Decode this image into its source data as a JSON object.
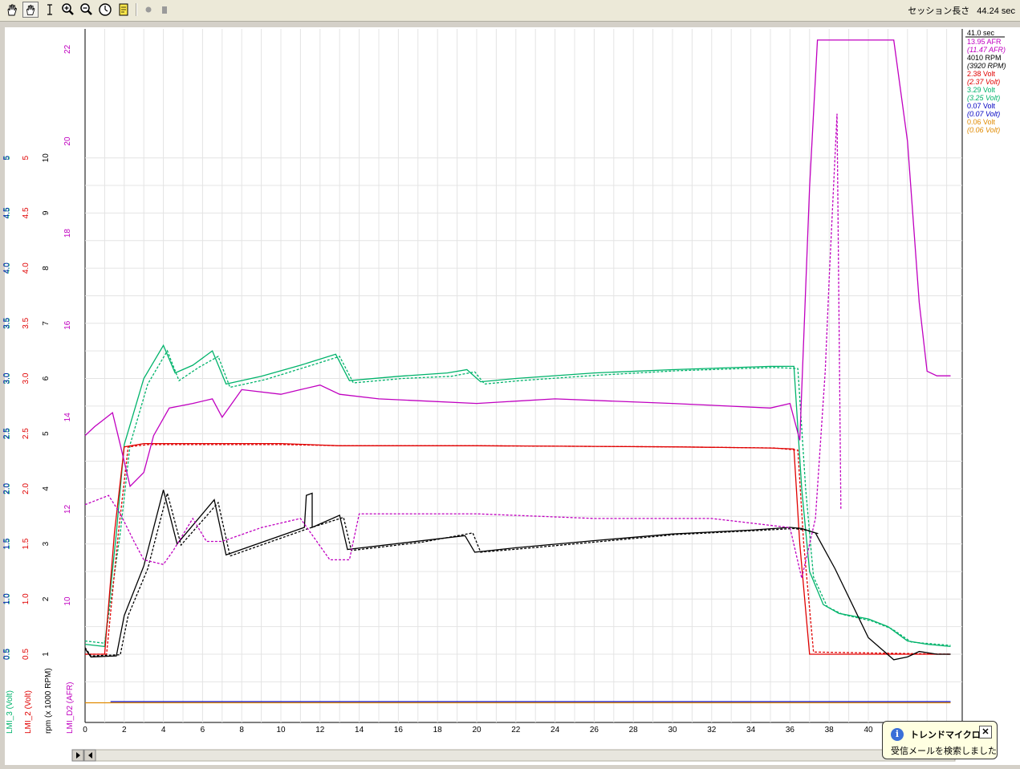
{
  "toolbar": {
    "icons": [
      "hand-icon",
      "pan-icon",
      "cursor-i-icon",
      "zoom-in-icon",
      "zoom-out-icon",
      "timer-icon",
      "notes-icon",
      "record-icon",
      "stop-icon"
    ],
    "session_label": "セッション長さ",
    "session_value": "44.24 sec"
  },
  "chart_data": {
    "type": "line",
    "x": {
      "range": [
        0,
        44.24
      ],
      "ticks": [
        0,
        2,
        4,
        6,
        8,
        10,
        12,
        14,
        16,
        18,
        20,
        22,
        24,
        26,
        28,
        30,
        32,
        34,
        36,
        38,
        40
      ]
    },
    "axes": [
      {
        "name": "LMI_3 (Volt)",
        "color": "#00b36b",
        "ticks": [
          "0.5",
          "1.0",
          "1.5",
          "2.0",
          "2.5",
          "3.0",
          "3.5",
          "4.0",
          "4.5",
          "5"
        ]
      },
      {
        "name": "LMI_2 (Volt)",
        "color": "#e00000",
        "ticks": [
          "0.5",
          "1.0",
          "1.5",
          "2.0",
          "2.5",
          "3.0",
          "3.5",
          "4.0",
          "4.5",
          "5"
        ]
      },
      {
        "name": "rpm (x 1000 RPM)",
        "color": "#000000",
        "ticks": [
          "1",
          "2",
          "3",
          "4",
          "5",
          "6",
          "7",
          "8",
          "9",
          "10"
        ]
      },
      {
        "name": "LMI_D2 (AFR)",
        "color": "#c000c0",
        "ticks": [
          "10",
          "12",
          "14",
          "16",
          "18",
          "20",
          "22"
        ]
      }
    ],
    "extra_axis": {
      "color": "#0000c0",
      "ticks": [
        "0.5",
        "1.0",
        "1.5",
        "2.0",
        "2.5",
        "3.0",
        "3.5",
        "4.0",
        "4.5",
        "5"
      ]
    },
    "cursor": {
      "time": "41.0 sec",
      "readouts": [
        {
          "text": "13.95 AFR",
          "color": "#c000c0",
          "italic": false
        },
        {
          "text": "(11.47 AFR)",
          "color": "#c000c0",
          "italic": true
        },
        {
          "text": "4010 RPM",
          "color": "#000000",
          "italic": false
        },
        {
          "text": "(3920 RPM)",
          "color": "#000000",
          "italic": true
        },
        {
          "text": "2.38 Volt",
          "color": "#e00000",
          "italic": false
        },
        {
          "text": "(2.37 Volt)",
          "color": "#e00000",
          "italic": true
        },
        {
          "text": "3.29 Volt",
          "color": "#00b36b",
          "italic": false
        },
        {
          "text": "(3.25 Volt)",
          "color": "#00b36b",
          "italic": true
        },
        {
          "text": "0.07 Volt",
          "color": "#0000c0",
          "italic": false
        },
        {
          "text": "(0.07 Volt)",
          "color": "#0000c0",
          "italic": true
        },
        {
          "text": "0.06 Volt",
          "color": "#e08a00",
          "italic": false
        },
        {
          "text": "(0.06 Volt)",
          "color": "#e08a00",
          "italic": true
        }
      ]
    },
    "series": [
      {
        "color": "#00b36b",
        "dashed": false,
        "points": [
          [
            0,
            0.59
          ],
          [
            1,
            0.57
          ],
          [
            1.6,
            1.6
          ],
          [
            2,
            2.4
          ],
          [
            3,
            3.0
          ],
          [
            4,
            3.3
          ],
          [
            4.6,
            3.05
          ],
          [
            5.5,
            3.12
          ],
          [
            6.5,
            3.25
          ],
          [
            7.2,
            2.95
          ],
          [
            9,
            3.02
          ],
          [
            11,
            3.12
          ],
          [
            12.8,
            3.22
          ],
          [
            13.5,
            2.98
          ],
          [
            16,
            3.02
          ],
          [
            18.5,
            3.05
          ],
          [
            19.5,
            3.08
          ],
          [
            20.2,
            2.97
          ],
          [
            22,
            3.0
          ],
          [
            26,
            3.05
          ],
          [
            30,
            3.08
          ],
          [
            35,
            3.11
          ],
          [
            36.2,
            3.11
          ],
          [
            36.6,
            2.0
          ],
          [
            37,
            1.25
          ],
          [
            37.7,
            0.95
          ],
          [
            38.5,
            0.87
          ],
          [
            40,
            0.82
          ],
          [
            41,
            0.75
          ],
          [
            42,
            0.62
          ],
          [
            43,
            0.59
          ],
          [
            44.2,
            0.57
          ]
        ]
      },
      {
        "color": "#00b36b",
        "dashed": true,
        "points": [
          [
            0,
            0.62
          ],
          [
            1,
            0.6
          ],
          [
            1.8,
            1.6
          ],
          [
            2.3,
            2.4
          ],
          [
            3.2,
            2.95
          ],
          [
            4.2,
            3.25
          ],
          [
            4.8,
            2.98
          ],
          [
            5.8,
            3.1
          ],
          [
            6.8,
            3.2
          ],
          [
            7.4,
            2.92
          ],
          [
            9.2,
            2.99
          ],
          [
            11.2,
            3.1
          ],
          [
            13,
            3.2
          ],
          [
            13.7,
            2.96
          ],
          [
            16.2,
            3.0
          ],
          [
            18.7,
            3.02
          ],
          [
            19.9,
            3.06
          ],
          [
            20.4,
            2.95
          ],
          [
            22.2,
            2.98
          ],
          [
            26.2,
            3.03
          ],
          [
            30.2,
            3.07
          ],
          [
            35.2,
            3.1
          ],
          [
            36.4,
            3.09
          ],
          [
            36.8,
            2.0
          ],
          [
            37.2,
            1.2
          ],
          [
            37.9,
            0.93
          ],
          [
            38.7,
            0.86
          ],
          [
            40.2,
            0.8
          ],
          [
            41.2,
            0.73
          ],
          [
            42.2,
            0.61
          ],
          [
            44.2,
            0.58
          ]
        ]
      },
      {
        "color": "#e00000",
        "dashed": false,
        "points": [
          [
            0,
            0.5
          ],
          [
            1,
            0.5
          ],
          [
            1.5,
            1.6
          ],
          [
            2,
            2.38
          ],
          [
            3,
            2.41
          ],
          [
            6,
            2.41
          ],
          [
            10,
            2.41
          ],
          [
            13,
            2.39
          ],
          [
            20,
            2.39
          ],
          [
            30,
            2.38
          ],
          [
            35,
            2.37
          ],
          [
            36.2,
            2.36
          ],
          [
            36.5,
            1.5
          ],
          [
            37,
            0.5
          ],
          [
            44.2,
            0.5
          ]
        ]
      },
      {
        "color": "#e00000",
        "dashed": true,
        "points": [
          [
            0,
            0.5
          ],
          [
            1.1,
            0.5
          ],
          [
            1.7,
            1.6
          ],
          [
            2.2,
            2.38
          ],
          [
            3.2,
            2.4
          ],
          [
            6.2,
            2.4
          ],
          [
            10.2,
            2.4
          ],
          [
            13.2,
            2.39
          ],
          [
            20.2,
            2.39
          ],
          [
            30.2,
            2.38
          ],
          [
            35.2,
            2.37
          ],
          [
            36.4,
            2.35
          ],
          [
            36.7,
            1.5
          ],
          [
            37.2,
            0.52
          ],
          [
            44.2,
            0.5
          ]
        ]
      },
      {
        "color": "#000000",
        "dashed": false,
        "points": [
          [
            0,
            1.1
          ],
          [
            0.3,
            0.95
          ],
          [
            1.6,
            0.97
          ],
          [
            2,
            1.7
          ],
          [
            3,
            2.6
          ],
          [
            4,
            3.98
          ],
          [
            4.7,
            3.0
          ],
          [
            6.6,
            3.8
          ],
          [
            7.2,
            2.8
          ],
          [
            11.2,
            3.3
          ],
          [
            11.3,
            3.88
          ],
          [
            11.6,
            3.92
          ],
          [
            11.6,
            3.3
          ],
          [
            13,
            3.52
          ],
          [
            13.4,
            2.9
          ],
          [
            17,
            3.05
          ],
          [
            19.4,
            3.15
          ],
          [
            19.9,
            2.85
          ],
          [
            22,
            2.93
          ],
          [
            26,
            3.06
          ],
          [
            30,
            3.18
          ],
          [
            34,
            3.25
          ],
          [
            36,
            3.3
          ],
          [
            36.6,
            3.28
          ],
          [
            37.3,
            3.2
          ],
          [
            38.3,
            2.55
          ],
          [
            40,
            1.3
          ],
          [
            41.3,
            0.9
          ],
          [
            42,
            0.95
          ],
          [
            42.6,
            1.05
          ],
          [
            43.5,
            1.0
          ],
          [
            44.2,
            1.0
          ]
        ]
      },
      {
        "color": "#000000",
        "dashed": true,
        "points": [
          [
            0,
            1.12
          ],
          [
            0.3,
            0.97
          ],
          [
            1.8,
            0.99
          ],
          [
            2.2,
            1.7
          ],
          [
            3.2,
            2.55
          ],
          [
            4.2,
            3.92
          ],
          [
            4.9,
            2.98
          ],
          [
            6.8,
            3.75
          ],
          [
            7.4,
            2.78
          ],
          [
            11.4,
            3.28
          ],
          [
            13.2,
            3.48
          ],
          [
            13.6,
            2.88
          ],
          [
            17.2,
            3.03
          ],
          [
            19.8,
            3.2
          ],
          [
            20.2,
            2.85
          ],
          [
            22.2,
            2.91
          ],
          [
            26.2,
            3.04
          ],
          [
            30.2,
            3.17
          ],
          [
            34.2,
            3.24
          ],
          [
            36.2,
            3.28
          ],
          [
            36.8,
            3.25
          ],
          [
            37.5,
            3.18
          ]
        ]
      },
      {
        "color": "#c000c0",
        "dashed": false,
        "points": [
          [
            0,
            13.6
          ],
          [
            0.5,
            13.8
          ],
          [
            1.4,
            14.1
          ],
          [
            1.8,
            13.4
          ],
          [
            2.3,
            12.5
          ],
          [
            3,
            12.8
          ],
          [
            3.5,
            13.6
          ],
          [
            4.3,
            14.2
          ],
          [
            5.5,
            14.3
          ],
          [
            6.5,
            14.4
          ],
          [
            7,
            14.0
          ],
          [
            8,
            14.6
          ],
          [
            10,
            14.5
          ],
          [
            11,
            14.6
          ],
          [
            12,
            14.7
          ],
          [
            13,
            14.5
          ],
          [
            15,
            14.4
          ],
          [
            20,
            14.3
          ],
          [
            24,
            14.4
          ],
          [
            30,
            14.3
          ],
          [
            35,
            14.2
          ],
          [
            36,
            14.3
          ],
          [
            36.5,
            13.5
          ],
          [
            37,
            19.0
          ],
          [
            37.4,
            22.2
          ],
          [
            40,
            22.2
          ],
          [
            41.3,
            22.2
          ],
          [
            42,
            20.0
          ],
          [
            42.6,
            16.5
          ],
          [
            43,
            15.0
          ],
          [
            43.5,
            14.9
          ],
          [
            44.2,
            14.9
          ]
        ]
      },
      {
        "color": "#c000c0",
        "dashed": true,
        "points": [
          [
            0,
            12.1
          ],
          [
            1.2,
            12.3
          ],
          [
            1.8,
            11.9
          ],
          [
            2.5,
            11.3
          ],
          [
            3,
            10.9
          ],
          [
            4,
            10.8
          ],
          [
            4.5,
            11.1
          ],
          [
            5.5,
            11.8
          ],
          [
            6.2,
            11.3
          ],
          [
            7,
            11.3
          ],
          [
            9,
            11.6
          ],
          [
            11,
            11.8
          ],
          [
            12.5,
            10.9
          ],
          [
            13.5,
            10.9
          ],
          [
            14,
            11.9
          ],
          [
            17,
            11.9
          ],
          [
            20,
            11.9
          ],
          [
            26,
            11.8
          ],
          [
            32,
            11.8
          ],
          [
            36,
            11.6
          ],
          [
            36.6,
            10.5
          ],
          [
            37.3,
            11.8
          ],
          [
            37.8,
            15.0
          ],
          [
            38,
            17.0
          ],
          [
            38.4,
            20.6
          ],
          [
            38.6,
            12.0
          ]
        ]
      },
      {
        "color": "#0000c0",
        "dashed": false,
        "points": [
          [
            1.3,
            0.07
          ],
          [
            44.2,
            0.07
          ]
        ]
      },
      {
        "color": "#e08a00",
        "dashed": false,
        "points": [
          [
            0,
            0.06
          ],
          [
            44.2,
            0.06
          ]
        ]
      }
    ]
  },
  "notification": {
    "title": "トレンドマイクロ",
    "message": "受信メールを検索しました",
    "close_label": "✕",
    "info_label": "i"
  }
}
